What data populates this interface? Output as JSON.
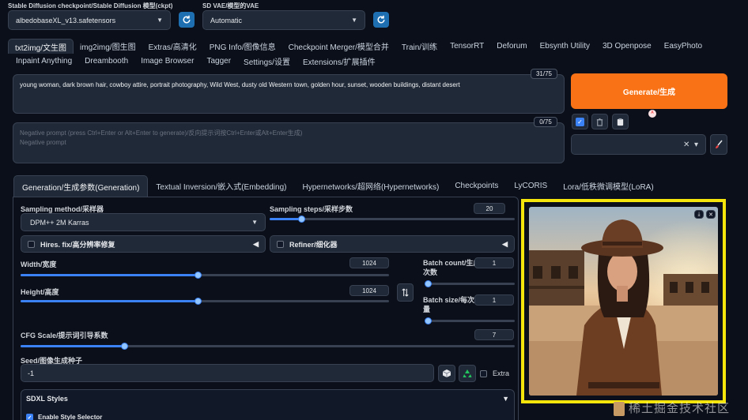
{
  "header": {
    "checkpoint_label": "Stable Diffusion checkpoint/Stable Diffusion 模型(ckpt)",
    "checkpoint_value": "albedobaseXL_v13.safetensors",
    "vae_label": "SD VAE/模型的VAE",
    "vae_value": "Automatic"
  },
  "main_tabs_row1": [
    "txt2img/文生图",
    "img2img/图生图",
    "Extras/高清化",
    "PNG Info/图像信息",
    "Checkpoint Merger/模型合并",
    "Train/训练",
    "TensorRT",
    "Deforum",
    "Ebsynth Utility",
    "3D Openpose",
    "EasyPhoto"
  ],
  "main_tabs_row2": [
    "Inpaint Anything",
    "Dreambooth",
    "Image Browser",
    "Tagger",
    "Settings/设置",
    "Extensions/扩展插件"
  ],
  "prompt": {
    "text": "young woman, dark brown hair, cowboy attire, portrait photography, Wild West, dusty old Western town, golden hour, sunset, wooden buildings, distant desert",
    "counter": "31/75"
  },
  "negative_prompt": {
    "placeholder_line1": "Negative prompt (press Ctrl+Enter or Alt+Enter to generate)/反向提示词按Ctrl+Enter或Alt+Enter生成)",
    "placeholder_line2": "Negative prompt",
    "counter": "0/75"
  },
  "generate_label": "Generate/生成",
  "sub_tabs": [
    "Generation/生成参数(Generation)",
    "Textual Inversion/嵌入式(Embedding)",
    "Hypernetworks/超网络(Hypernetworks)",
    "Checkpoints",
    "LyCORIS",
    "Lora/低秩微调模型(LoRA)"
  ],
  "generation": {
    "sampling_method_label": "Sampling method/采样器",
    "sampling_method_value": "DPM++ 2M Karras",
    "sampling_steps_label": "Sampling steps/采样步数",
    "sampling_steps_value": "20",
    "sampling_steps_fraction": 0.13,
    "hires_label": "Hires. fix/高分辨率修复",
    "refiner_label": "Refiner/细化器",
    "width_label": "Width/宽度",
    "width_value": "1024",
    "width_fraction": 0.48,
    "height_label": "Height/高度",
    "height_value": "1024",
    "height_fraction": 0.48,
    "batch_count_label_1": "Batch count/生成",
    "batch_count_label_2": "次数",
    "batch_count_value": "1",
    "batch_count_fraction": 0.0,
    "batch_size_label_1": "Batch size/每次数",
    "batch_size_label_2": "量",
    "batch_size_value": "1",
    "batch_size_fraction": 0.0,
    "cfg_label": "CFG Scale/提示词引导系数",
    "cfg_value": "7",
    "cfg_fraction": 0.21,
    "seed_label": "Seed/图像生成种子",
    "seed_value": "-1",
    "extra_label": "Extra",
    "sdxl_styles_label": "SDXL Styles",
    "enable_style_selector_label": "Enable Style Selector"
  },
  "watermark": "稀土掘金技术社区",
  "colors": {
    "background": "#0b0f19",
    "generate_button": "#f97316",
    "highlight_border": "#f5e50b",
    "slider_accent": "#3b82f6",
    "refresh_button": "#1e6fb1"
  }
}
